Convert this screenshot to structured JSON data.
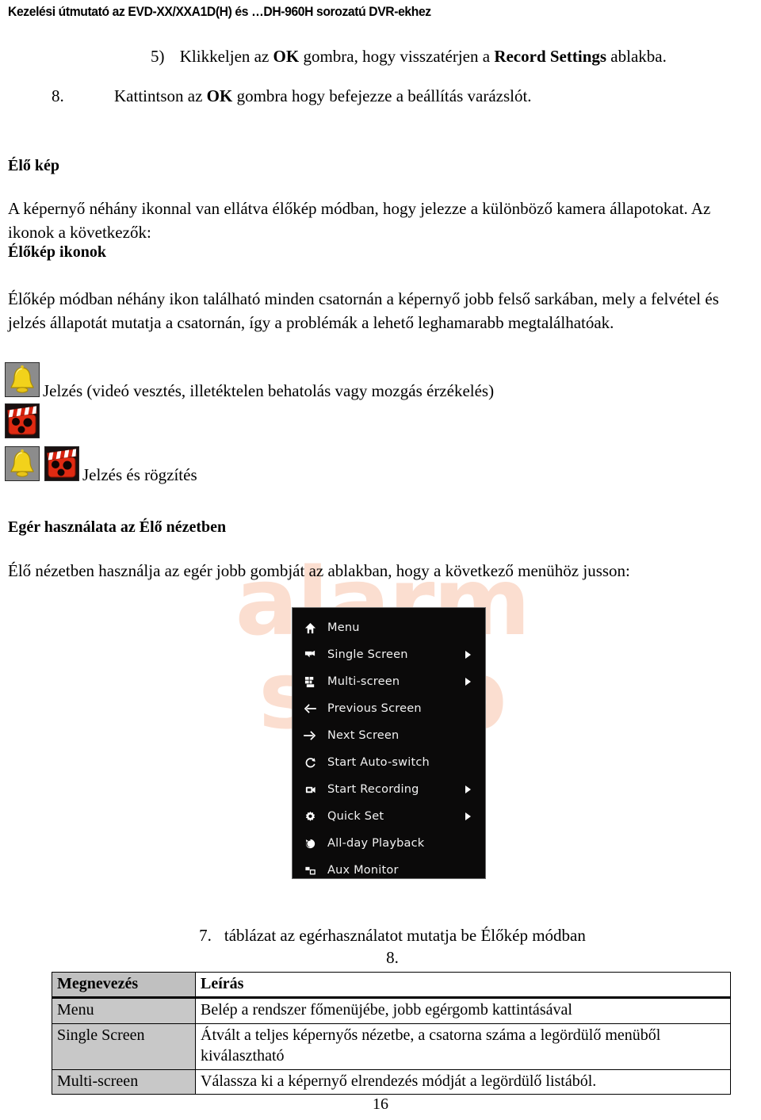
{
  "header": {
    "running_head": "Kezelési útmutató az EVD-XX/XXA1D(H) és …DH-960H sorozatú DVR-ekhez"
  },
  "steps": [
    {
      "marker": "5)",
      "parts": [
        {
          "text": "Klikkeljen az ",
          "bold": false
        },
        {
          "text": "OK",
          "bold": true
        },
        {
          "text": " gombra, hogy visszatérjen a ",
          "bold": false
        },
        {
          "text": "Record Settings",
          "bold": true
        },
        {
          "text": " ablakba.",
          "bold": false
        }
      ],
      "full_text": "5) Klikkeljen az OK gombra, hogy visszatérjen a Record Settings ablakba."
    },
    {
      "marker": "8.",
      "parts": [
        {
          "text": "Kattintson az ",
          "bold": false
        },
        {
          "text": "OK",
          "bold": true
        },
        {
          "text": " gombra hogy befejezze a beállítás varázslót.",
          "bold": false
        }
      ],
      "full_text": "8. Kattintson az OK gombra hogy befejezze a beállítás varázslót."
    }
  ],
  "sections": {
    "live_view_heading": "Élő kép",
    "live_view_paragraph": "A képernyő néhány ikonnal van ellátva élőkép módban, hogy jelezze a különböző kamera állapotokat. Az ikonok a következők:",
    "icons_heading": "Élőkép ikonok",
    "icons_paragraph": "Élőkép módban néhány ikon található minden csatornán a képernyő jobb felső sarkában, mely a felvétel és jelzés állapotát mutatja a csatornán, így a problémák a lehető leghamarabb megtalálhatóak.",
    "mouse_heading": "Egér használata az Élő nézetben",
    "mouse_paragraph": "Élő nézetben használja az egér jobb gombját az ablakban, hogy a következő menühöz jusson:"
  },
  "status_icons": [
    {
      "icon": "alarm-bell-icon",
      "label": "Jelzés (videó vesztés, illetéktelen behatolás vagy mozgás érzékelés)"
    },
    {
      "icon": "alarm-bell-and-record-icon",
      "label": "Jelzés és rögzítés"
    }
  ],
  "context_menu": {
    "items": [
      {
        "icon": "home-icon",
        "label": "Menu",
        "has_submenu": false
      },
      {
        "icon": "single-screen-icon",
        "label": "Single Screen",
        "has_submenu": true
      },
      {
        "icon": "multi-screen-icon",
        "label": "Multi-screen",
        "has_submenu": true
      },
      {
        "icon": "arrow-left-icon",
        "label": "Previous Screen",
        "has_submenu": false
      },
      {
        "icon": "arrow-right-icon",
        "label": "Next Screen",
        "has_submenu": false
      },
      {
        "icon": "auto-switch-icon",
        "label": "Start Auto-switch",
        "has_submenu": false
      },
      {
        "icon": "record-camera-icon",
        "label": "Start Recording",
        "has_submenu": true
      },
      {
        "icon": "gear-icon",
        "label": "Quick Set",
        "has_submenu": true
      },
      {
        "icon": "playback-icon",
        "label": "All-day Playback",
        "has_submenu": false
      },
      {
        "icon": "aux-monitor-icon",
        "label": "Aux Monitor",
        "has_submenu": false
      }
    ]
  },
  "table_caption": {
    "number": "7.",
    "text": "táblázat az egérhasználatot mutatja be Élőkép módban",
    "second_line": "8."
  },
  "mouse_table": {
    "headers": [
      "Megnevezés",
      "Leírás"
    ],
    "rows": [
      {
        "name": "Menu",
        "description": "Belép a rendszer főmenüjébe, jobb egérgomb kattintásával"
      },
      {
        "name": "Single Screen",
        "description": "Átvált a teljes képernyős nézetbe, a csatorna száma a legördülő menüből kiválasztható"
      },
      {
        "name": "Multi-screen",
        "description": "Válassza ki a képernyő elrendezés módját a legördülő listából."
      }
    ]
  },
  "watermark": {
    "text": "alarm shop",
    "color": "#fbded0"
  },
  "page_number": "16"
}
